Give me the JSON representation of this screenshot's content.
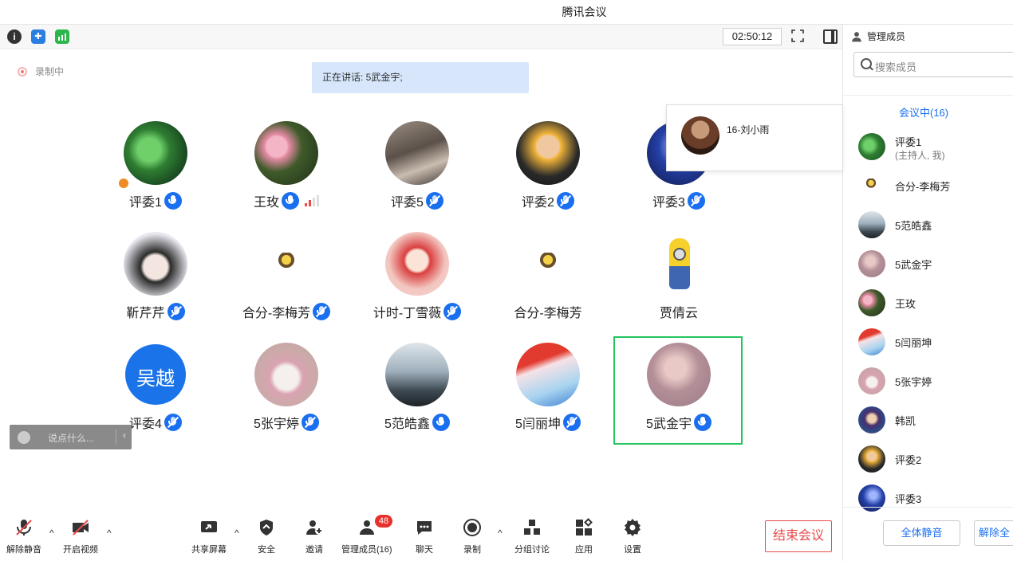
{
  "window": {
    "title": "腾讯会议"
  },
  "topbar": {
    "timer": "02:50:12",
    "icons": [
      "info-icon",
      "shield-icon",
      "signal-icon",
      "fullscreen-icon",
      "layout-icon"
    ]
  },
  "recording_label": "录制中",
  "speaking_banner": "正在讲话: 5武金宇;",
  "popup": {
    "name": "16-刘小雨"
  },
  "tiles": [
    {
      "name": "评委1",
      "mic": "on",
      "host": true
    },
    {
      "name": "王玫",
      "mic": "on",
      "weak_signal": true
    },
    {
      "name": "评委5",
      "mic": "off"
    },
    {
      "name": "评委2",
      "mic": "off"
    },
    {
      "name": "评委3",
      "mic": "off"
    },
    {
      "name": "靳芹芹",
      "mic": "off"
    },
    {
      "name": "合分-李梅芳",
      "mic": "off"
    },
    {
      "name": "计时-丁雪薇",
      "mic": "off"
    },
    {
      "name": "合分-李梅芳",
      "mic": "none"
    },
    {
      "name": "贾倩云",
      "mic": "none"
    },
    {
      "name": "评委4",
      "mic": "off",
      "avatar_text": "吴越"
    },
    {
      "name": "5张宇婷",
      "mic": "off"
    },
    {
      "name": "5范皓鑫",
      "mic": "on"
    },
    {
      "name": "5闫丽坤",
      "mic": "off"
    },
    {
      "name": "5武金宇",
      "mic": "on",
      "active": true
    }
  ],
  "chat_input": {
    "placeholder": "说点什么..."
  },
  "bottombar": {
    "unmute": "解除静音",
    "start_video": "开启视频",
    "share_screen": "共享屏幕",
    "security": "安全",
    "invite": "邀请",
    "manage_members": "管理成员(16)",
    "manage_badge": "48",
    "chat": "聊天",
    "record": "录制",
    "breakout": "分组讨论",
    "apps": "应用",
    "settings": "设置",
    "end_meeting": "结束会议"
  },
  "panel": {
    "header": "管理成员",
    "search_placeholder": "搜索成员",
    "tab": "会议中(16)",
    "members": [
      {
        "name": "评委1",
        "sub": "(主持人, 我)"
      },
      {
        "name": "合分-李梅芳"
      },
      {
        "name": "5范皓鑫"
      },
      {
        "name": "5武金宇"
      },
      {
        "name": "王玫"
      },
      {
        "name": "5闫丽坤"
      },
      {
        "name": "5张宇婷"
      },
      {
        "name": "韩凯"
      },
      {
        "name": "评委2"
      },
      {
        "name": "评委3"
      }
    ],
    "mute_all": "全体静音",
    "unmute_all": "解除全"
  },
  "colors": {
    "accent": "#1a6ff0",
    "end": "#e84a4a",
    "active_frame": "#22c55e",
    "badge": "#e6312c"
  }
}
